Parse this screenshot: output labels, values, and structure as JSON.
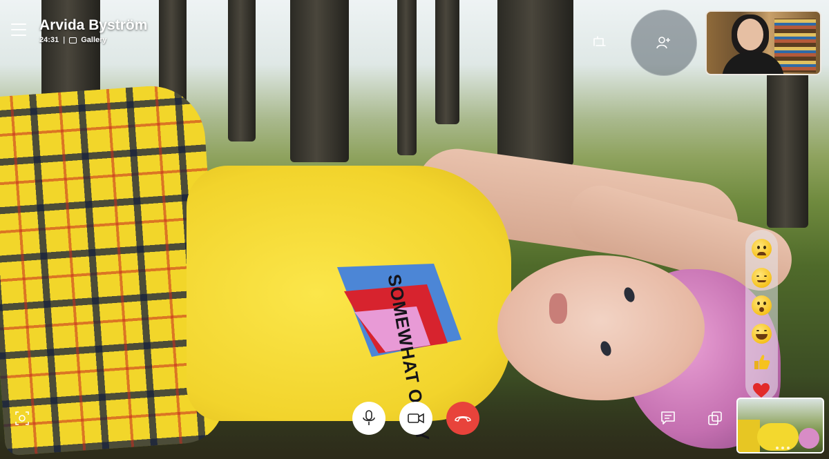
{
  "header": {
    "caller_name": "Arvida Byström",
    "call_duration": "24:31",
    "separator": "|",
    "view_mode": "Gallery"
  },
  "video": {
    "shirt_text": "SOMEWHAT OKAY"
  },
  "icons": {
    "menu": "hamburger-menu-icon",
    "share_screen": "share-screen-icon",
    "add_participant": "add-person-icon",
    "snapshot": "camera-snapshot-icon",
    "chat": "chat-bubble-icon",
    "switch_camera": "switch-view-icon",
    "mic": "microphone-icon",
    "video": "video-camera-icon",
    "end_call": "hang-up-icon"
  },
  "reactions": [
    "sad",
    "relieved",
    "surprised",
    "laughing",
    "thumbs-up",
    "heart"
  ],
  "colors": {
    "end_call": "#e8433b",
    "emoji": "#f6c21e",
    "heart": "#e22a2a"
  }
}
